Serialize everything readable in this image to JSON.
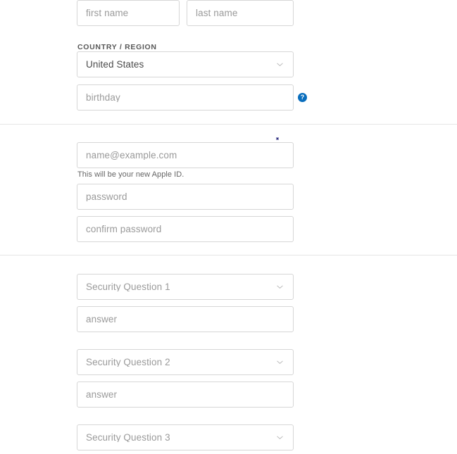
{
  "sections": {
    "personal": {
      "name_fields": [
        {
          "name": "first-name",
          "placeholder": "first name",
          "value": ""
        },
        {
          "name": "last-name",
          "placeholder": "last name",
          "value": ""
        }
      ],
      "country_label": "COUNTRY / REGION",
      "country_select": {
        "name": "country-region",
        "value": "United States",
        "icon": "chevron-down-icon"
      },
      "birthday_field": {
        "name": "birthday",
        "placeholder": "birthday",
        "value": ""
      },
      "birthday_help": {
        "name": "help-icon",
        "glyph": "?",
        "color": "#0a6ebd"
      }
    },
    "account": {
      "email_field": {
        "name": "email",
        "placeholder": "name@example.com",
        "value": ""
      },
      "email_helper_text": "This will be your new Apple ID.",
      "password_field": {
        "name": "password",
        "placeholder": "password",
        "value": ""
      },
      "confirm_password_field": {
        "name": "confirm-password",
        "placeholder": "confirm password",
        "value": ""
      }
    },
    "security": {
      "items": [
        {
          "question": {
            "name": "security-question-1",
            "value": "Security Question 1",
            "icon": "chevron-down-icon"
          },
          "answer": {
            "name": "security-answer-1",
            "placeholder": "answer",
            "value": ""
          }
        },
        {
          "question": {
            "name": "security-question-2",
            "value": "Security Question 2",
            "icon": "chevron-down-icon"
          },
          "answer": {
            "name": "security-answer-2",
            "placeholder": "answer",
            "value": ""
          }
        },
        {
          "question": {
            "name": "security-question-3",
            "value": "Security Question 3",
            "icon": "chevron-down-icon"
          }
        }
      ]
    }
  },
  "colors": {
    "accent": "#0a6ebd",
    "field_border": "#d6d6d6",
    "divider": "#e6e6e6",
    "placeholder_text": "#9a9a9a",
    "value_text": "#4a4a4a",
    "label_text": "#585858",
    "helper_text": "#666666",
    "background": "#ffffff"
  }
}
